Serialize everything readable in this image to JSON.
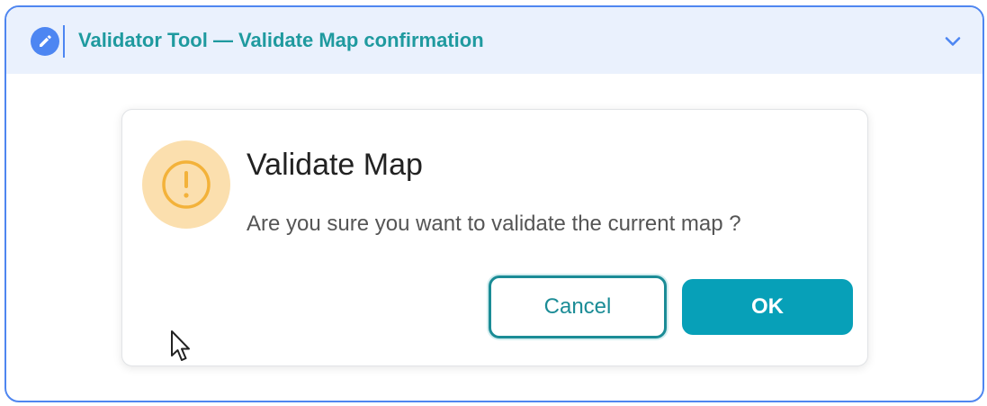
{
  "header": {
    "title": "Validator Tool — Validate Map confirmation",
    "icon": "pencil-icon",
    "collapse_icon": "chevron-down-icon",
    "accent_color": "#4d86f2",
    "title_color": "#1f9a9f"
  },
  "dialog": {
    "icon": "warning-icon",
    "title": "Validate Map",
    "message": "Are you sure you want to validate the current map ?",
    "buttons": {
      "cancel_label": "Cancel",
      "ok_label": "OK"
    },
    "primary_color": "#07a0b8",
    "warning_color": "#f3b23a"
  },
  "cursor": "mouse-pointer-icon"
}
